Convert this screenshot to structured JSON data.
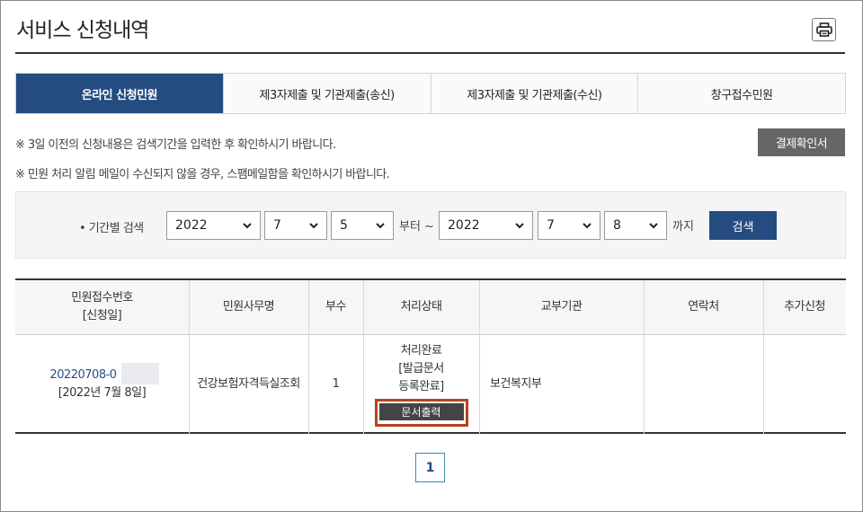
{
  "page": {
    "title": "서비스 신청내역"
  },
  "tabs": [
    {
      "label": "온라인 신청민원",
      "active": true
    },
    {
      "label": "제3자제출 및 기관제출(송신)",
      "active": false
    },
    {
      "label": "제3자제출 및 기관제출(수신)",
      "active": false
    },
    {
      "label": "창구접수민원",
      "active": false
    }
  ],
  "notices": [
    "※ 3일 이전의 신청내용은 검색기간을 입력한 후 확인하시기 바랍니다.",
    "※ 민원 처리 알림 메일이 수신되지 않을 경우, 스팸메일함을 확인하시기 바랍니다."
  ],
  "payment_button": "결제확인서",
  "search": {
    "label": "• 기간별 검색",
    "from": {
      "year": "2022",
      "month": "7",
      "day": "5"
    },
    "from_suffix": "부터 ~",
    "to": {
      "year": "2022",
      "month": "7",
      "day": "8"
    },
    "to_suffix": "까지",
    "button": "검색"
  },
  "table": {
    "headers": {
      "receipt_no_line1": "민원접수번호",
      "receipt_no_line2": "[신청일]",
      "service": "민원사무명",
      "copies": "부수",
      "status": "처리상태",
      "agency": "교부기관",
      "contact": "연락처",
      "extra": "추가신청"
    },
    "rows": [
      {
        "receipt_no": "20220708-0",
        "date": "[2022년 7월 8일]",
        "service": "건강보험자격득실조회",
        "copies": "1",
        "status_line1": "처리완료",
        "status_line2": "[발급문서",
        "status_line3": "등록완료]",
        "print_button": "문서출력",
        "agency": "보건복지부",
        "contact": "",
        "extra": ""
      }
    ]
  },
  "pagination": {
    "current": "1"
  },
  "colors": {
    "primary": "#244c81",
    "highlight": "#b5431b"
  },
  "icons": {
    "print": "printer-icon",
    "dropdown": "chevron-down-icon"
  }
}
